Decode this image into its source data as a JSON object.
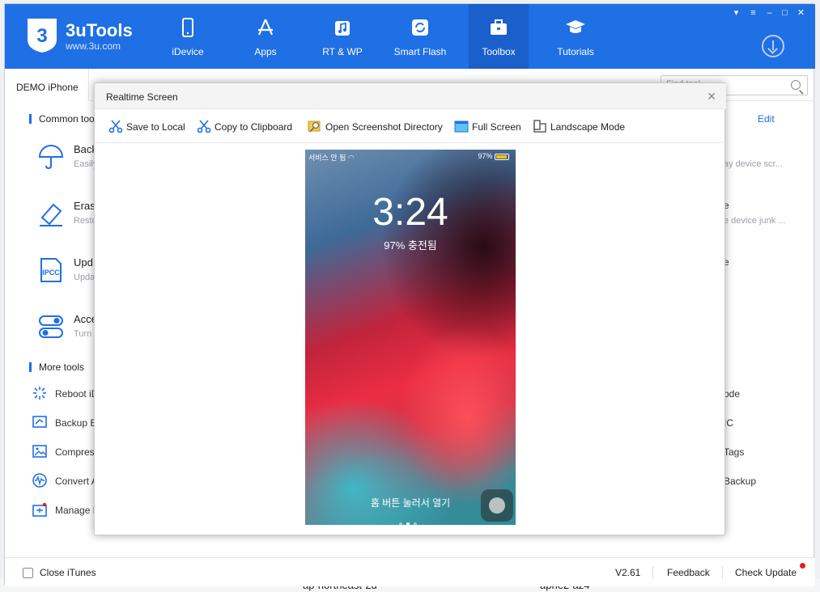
{
  "app": {
    "brand": "3uTools",
    "url": "www.3u.com"
  },
  "nav": [
    {
      "label": "iDevice",
      "icon": "phone-icon"
    },
    {
      "label": "Apps",
      "icon": "appstore-icon"
    },
    {
      "label": "RT & WP",
      "icon": "music-icon"
    },
    {
      "label": "Smart Flash",
      "icon": "flash-icon"
    },
    {
      "label": "Toolbox",
      "icon": "toolbox-icon",
      "active": true
    },
    {
      "label": "Tutorials",
      "icon": "graduation-icon"
    }
  ],
  "device_tab": "DEMO iPhone",
  "find_placeholder": "Find tool",
  "common_tools": {
    "heading": "Common tools",
    "items": [
      {
        "title": "Back",
        "sub": "Easily"
      },
      {
        "title": "Eras",
        "sub": "Resto"
      },
      {
        "title": "Upd",
        "sub": "Upda"
      },
      {
        "title": "Acce",
        "sub": "Turn"
      }
    ]
  },
  "more_tools": {
    "heading": "More tools",
    "items": [
      "Reboot iD",
      "Backup B",
      "Compres",
      "Convert A",
      "Manage D"
    ]
  },
  "edit_label": "Edit",
  "right_col": {
    "sub1": "ay device scr...",
    "title2": "e",
    "sub2": "e device junk ...",
    "title3": "e",
    "more": [
      "ode",
      "IC",
      "Tags",
      "Backup"
    ]
  },
  "status": {
    "close_itunes": "Close iTunes",
    "version": "V2.61",
    "feedback": "Feedback",
    "check_update": "Check Update"
  },
  "bg_bottom": {
    "left": "ap-northeast-2d",
    "mid": "apne2-az4"
  },
  "dialog": {
    "title": "Realtime Screen",
    "toolbar": [
      "Save to Local",
      "Copy to Clipboard",
      "Open Screenshot Directory",
      "Full Screen",
      "Landscape Mode"
    ]
  },
  "phone": {
    "carrier": "서비스 안 됨",
    "battery": "97%",
    "time": "3:24",
    "charge": "97% 충전됨",
    "unlock": "홈 버튼 눌러서 열기"
  }
}
